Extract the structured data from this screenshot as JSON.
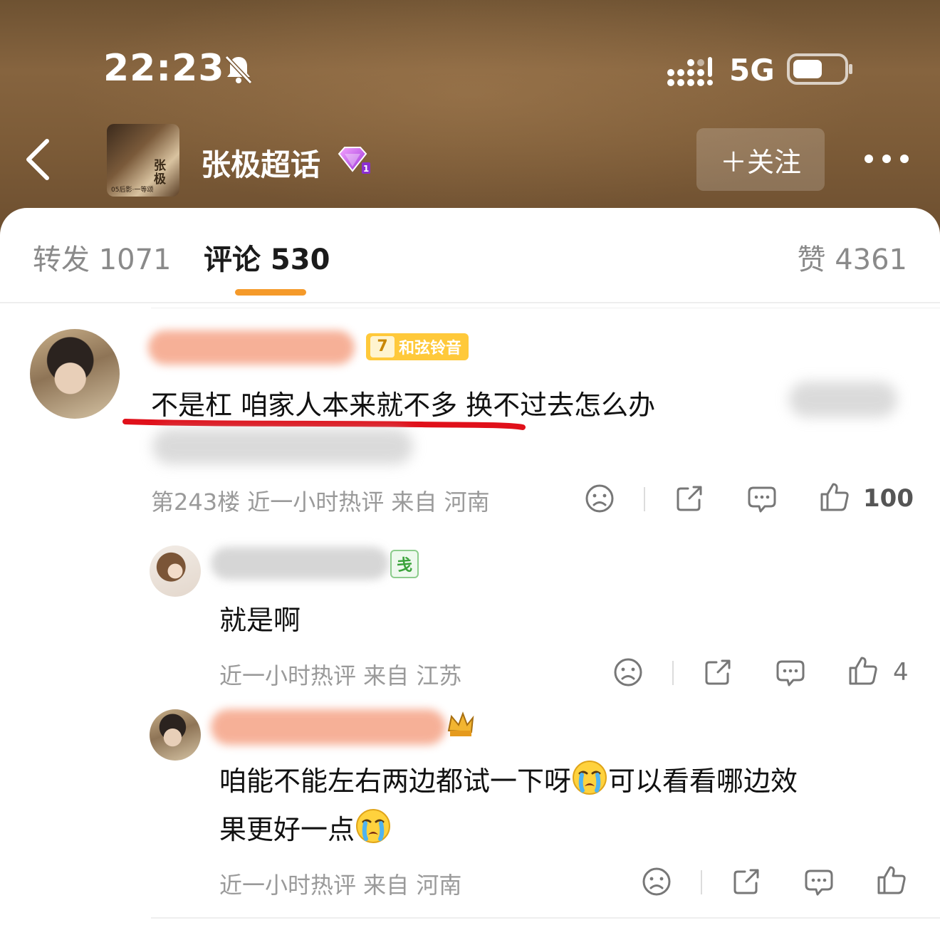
{
  "status_bar": {
    "time": "22:23",
    "network": "5G",
    "icons": [
      "bell-mute-icon",
      "signal-icon",
      "battery-icon"
    ]
  },
  "header": {
    "back_icon": "chevron-left-icon",
    "topic_title": "张极超话",
    "avatar_text": "张极",
    "avatar_sub": "05后影·一等颂",
    "vip_icon": "diamond-icon",
    "follow_label": "＋关注",
    "more_icon": "ellipsis-icon"
  },
  "tabs": {
    "reposts": "转发 1071",
    "comments": "评论 530",
    "likes": "赞 4361",
    "active": "comments",
    "accent": "#f59a2a"
  },
  "comments": [
    {
      "badge_level": "7",
      "badge_label": "和弦铃音",
      "text": "不是杠  咱家人本来就不多  换不过去怎么办",
      "meta": "第243楼  近一小时热评  来自  河南",
      "likes": "100",
      "underline_color": "#e0101a"
    },
    {
      "badge_label": "戋",
      "text": "就是啊",
      "meta": "近一小时热评  来自  江苏",
      "likes": "4"
    },
    {
      "text_part1": "咱能不能左右两边都试一下呀",
      "text_part2": "可以看看哪边效",
      "text_line2": "果更好一点",
      "emoji": "crying-face-emoji",
      "meta": "近一小时热评  来自  河南",
      "likes": ""
    }
  ]
}
